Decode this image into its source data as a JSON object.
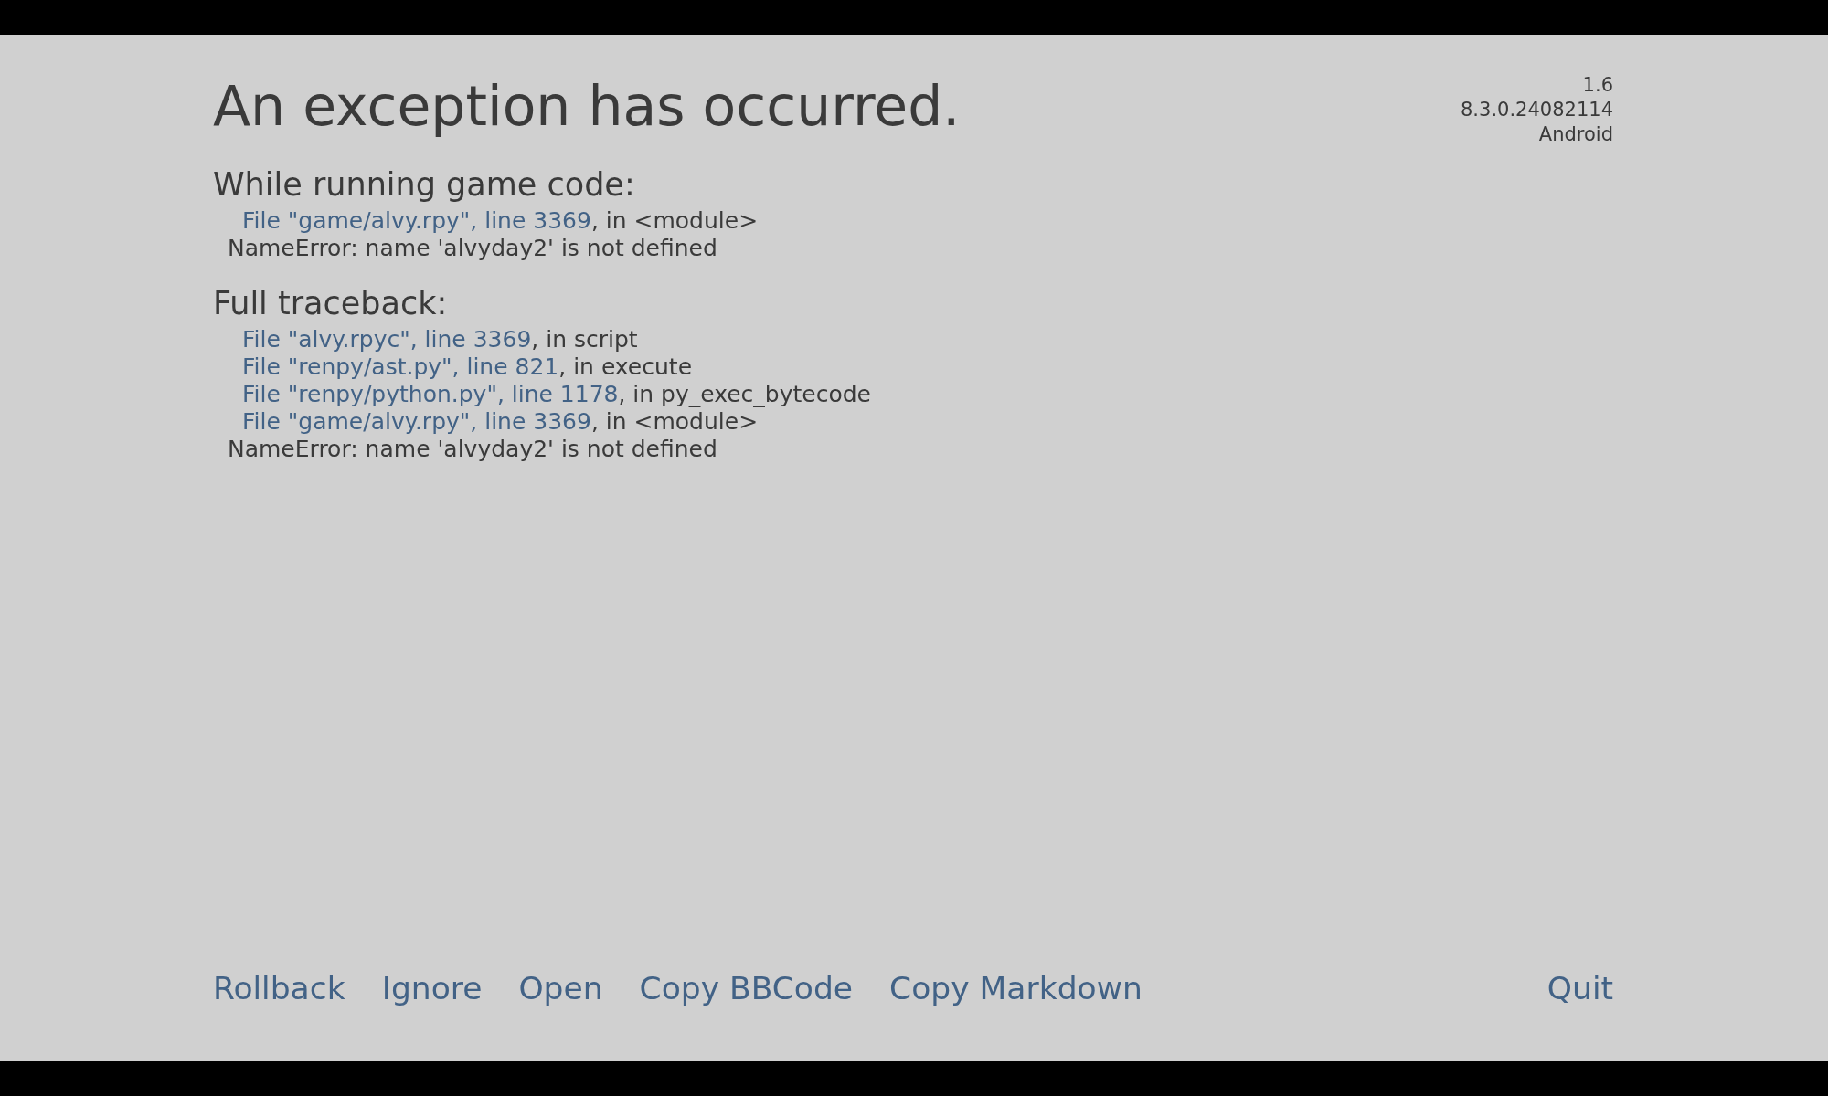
{
  "title": "An exception has occurred.",
  "version_info": [
    "1.6",
    "8.3.0.24082114",
    "Android"
  ],
  "sections": [
    {
      "heading": "While running game code:",
      "frames": [
        {
          "link": "File \"game/alvy.rpy\", line 3369",
          "text": ", in <module>"
        }
      ],
      "error": "NameError: name 'alvyday2' is not defined"
    },
    {
      "heading": "Full traceback:",
      "frames": [
        {
          "link": "File \"alvy.rpyc\", line 3369",
          "text": ", in script"
        },
        {
          "link": "File \"renpy/ast.py\", line 821",
          "text": ", in execute"
        },
        {
          "link": "File \"renpy/python.py\", line 1178",
          "text": ", in py_exec_bytecode"
        },
        {
          "link": "File \"game/alvy.rpy\", line 3369",
          "text": ", in <module>"
        }
      ],
      "error": "NameError: name 'alvyday2' is not defined"
    }
  ],
  "buttons": [
    "Rollback",
    "Ignore",
    "Open",
    "Copy BBCode",
    "Copy Markdown"
  ],
  "quit_button": "Quit"
}
